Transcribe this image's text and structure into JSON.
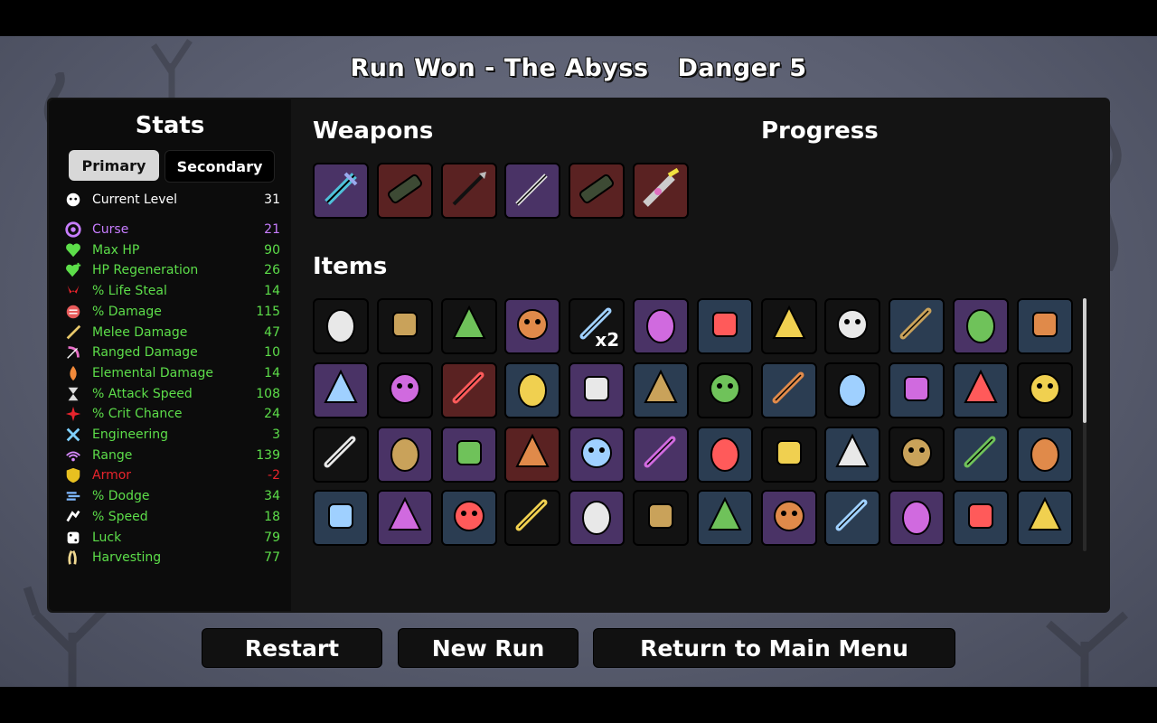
{
  "header": {
    "run_result": "Run Won - The Abyss",
    "danger": "Danger 5"
  },
  "stats": {
    "title": "Stats",
    "tabs": [
      "Primary",
      "Secondary"
    ],
    "rows": [
      {
        "label": "Current Level",
        "value": "31",
        "color": "#ffffff",
        "icon": "level-icon"
      },
      {
        "label": "Curse",
        "value": "21",
        "color": "#c77dff",
        "icon": "curse-icon"
      },
      {
        "label": "Max HP",
        "value": "90",
        "color": "#5dde4a",
        "icon": "heart-icon"
      },
      {
        "label": "HP Regeneration",
        "value": "26",
        "color": "#5dde4a",
        "icon": "regen-icon"
      },
      {
        "label": "% Life Steal",
        "value": "14",
        "color": "#5dde4a",
        "icon": "life-steal-icon"
      },
      {
        "label": "% Damage",
        "value": "115",
        "color": "#5dde4a",
        "icon": "damage-icon"
      },
      {
        "label": "Melee Damage",
        "value": "47",
        "color": "#5dde4a",
        "icon": "melee-icon"
      },
      {
        "label": "Ranged Damage",
        "value": "10",
        "color": "#5dde4a",
        "icon": "ranged-icon"
      },
      {
        "label": "Elemental Damage",
        "value": "14",
        "color": "#5dde4a",
        "icon": "elemental-icon"
      },
      {
        "label": "% Attack Speed",
        "value": "108",
        "color": "#5dde4a",
        "icon": "attack-speed-icon"
      },
      {
        "label": "% Crit Chance",
        "value": "24",
        "color": "#5dde4a",
        "icon": "crit-icon"
      },
      {
        "label": "Engineering",
        "value": "3",
        "color": "#5dde4a",
        "icon": "engineering-icon"
      },
      {
        "label": "Range",
        "value": "139",
        "color": "#5dde4a",
        "icon": "range-icon"
      },
      {
        "label": "Armor",
        "value": "-2",
        "color": "#e8242c",
        "icon": "armor-icon"
      },
      {
        "label": "% Dodge",
        "value": "34",
        "color": "#5dde4a",
        "icon": "dodge-icon"
      },
      {
        "label": "% Speed",
        "value": "18",
        "color": "#5dde4a",
        "icon": "speed-icon"
      },
      {
        "label": "Luck",
        "value": "79",
        "color": "#5dde4a",
        "icon": "luck-icon"
      },
      {
        "label": "Harvesting",
        "value": "77",
        "color": "#5dde4a",
        "icon": "harvesting-icon"
      }
    ]
  },
  "weapons": {
    "title": "Weapons",
    "list": [
      {
        "name": "chain-weapon-icon",
        "tier": "purple"
      },
      {
        "name": "rocket-launcher-icon",
        "tier": "red"
      },
      {
        "name": "spear-icon",
        "tier": "red"
      },
      {
        "name": "sword-icon",
        "tier": "purple"
      },
      {
        "name": "rocket-launcher-icon",
        "tier": "red"
      },
      {
        "name": "laser-gun-icon",
        "tier": "red"
      }
    ]
  },
  "progress": {
    "title": "Progress"
  },
  "items": {
    "title": "Items",
    "list": [
      {
        "name": "ghost-egg-icon",
        "tier": "black"
      },
      {
        "name": "hooded-figure-icon",
        "tier": "black"
      },
      {
        "name": "sprout-icon",
        "tier": "black"
      },
      {
        "name": "golden-statue-icon",
        "tier": "purple"
      },
      {
        "name": "scroll-icon",
        "tier": "black",
        "qty": "x2"
      },
      {
        "name": "mirror-icon",
        "tier": "purple"
      },
      {
        "name": "medic-turret-icon",
        "tier": "blue"
      },
      {
        "name": "fang-icon",
        "tier": "black"
      },
      {
        "name": "creature-icon",
        "tier": "black"
      },
      {
        "name": "worm-icon",
        "tier": "blue"
      },
      {
        "name": "goldfish-icon",
        "tier": "purple"
      },
      {
        "name": "garden-icon",
        "tier": "blue"
      },
      {
        "name": "bowler-hat-icon",
        "tier": "purple"
      },
      {
        "name": "skull-mask-icon",
        "tier": "black"
      },
      {
        "name": "mammoth-icon",
        "tier": "red"
      },
      {
        "name": "antlers-icon",
        "tier": "blue"
      },
      {
        "name": "ring-icon",
        "tier": "purple"
      },
      {
        "name": "cocoon-icon",
        "tier": "blue"
      },
      {
        "name": "snake-icon",
        "tier": "black"
      },
      {
        "name": "campfire-icon",
        "tier": "blue"
      },
      {
        "name": "book-icon",
        "tier": "black"
      },
      {
        "name": "scope-icon",
        "tier": "blue"
      },
      {
        "name": "spots-icon",
        "tier": "blue"
      },
      {
        "name": "boxing-glove-icon",
        "tier": "black"
      },
      {
        "name": "syringe-icon",
        "tier": "black"
      },
      {
        "name": "tools-icon",
        "tier": "purple"
      },
      {
        "name": "goblet-icon",
        "tier": "purple"
      },
      {
        "name": "stone-head-icon",
        "tier": "red"
      },
      {
        "name": "jar-icon",
        "tier": "purple"
      },
      {
        "name": "claw-marks-icon",
        "tier": "purple"
      },
      {
        "name": "stairs-icon",
        "tier": "blue"
      },
      {
        "name": "hedgehog-icon",
        "tier": "black"
      },
      {
        "name": "robot-face-icon",
        "tier": "blue"
      },
      {
        "name": "helmet-icon",
        "tier": "black"
      },
      {
        "name": "wasp-icon",
        "tier": "blue"
      },
      {
        "name": "treasure-map-icon",
        "tier": "blue"
      },
      {
        "name": "cauldron-icon",
        "tier": "blue"
      },
      {
        "name": "wings-icon",
        "tier": "purple"
      },
      {
        "name": "village-icon",
        "tier": "blue"
      },
      {
        "name": "whistle-icon",
        "tier": "black"
      },
      {
        "name": "sack-icon",
        "tier": "purple"
      },
      {
        "name": "ghost-icon",
        "tier": "black"
      },
      {
        "name": "crane-icon",
        "tier": "blue"
      },
      {
        "name": "mushrooms-icon",
        "tier": "purple"
      },
      {
        "name": "crown-icon",
        "tier": "blue"
      },
      {
        "name": "clover-icon",
        "tier": "purple"
      },
      {
        "name": "bullet-icon",
        "tier": "blue"
      },
      {
        "name": "ketchup-icon",
        "tier": "blue"
      }
    ]
  },
  "buttons": {
    "restart": "Restart",
    "new_run": "New Run",
    "main_menu": "Return to Main Menu"
  },
  "tier_colors": {
    "black": "#121212",
    "purple": "#4a3366",
    "blue": "#2b3d52",
    "red": "#5a2222"
  }
}
